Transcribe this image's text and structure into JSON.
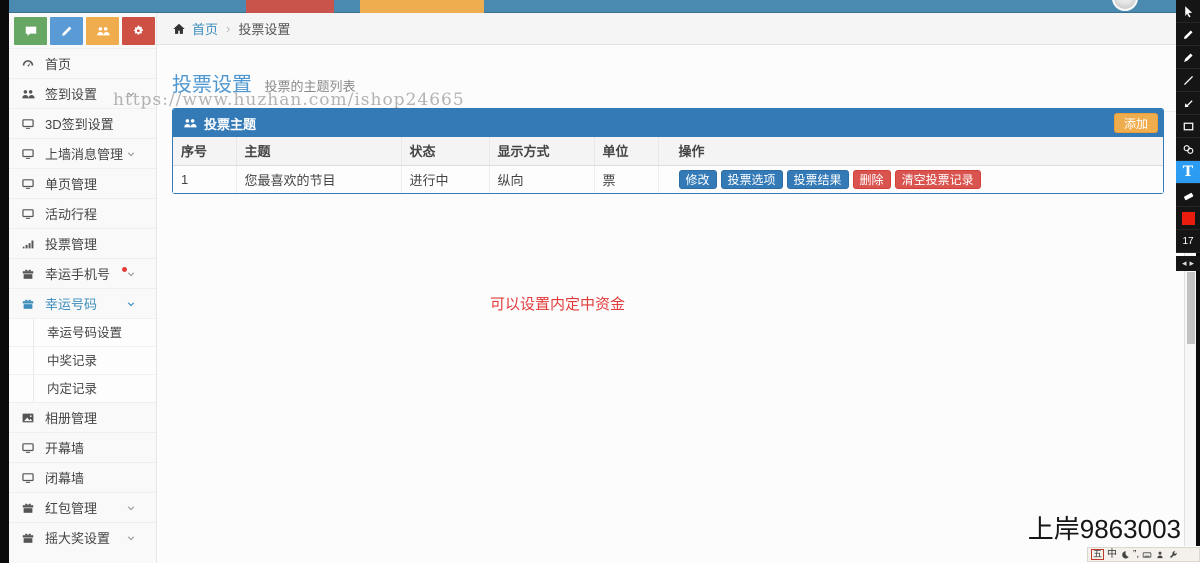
{
  "colors": {
    "navbar": "#4a8ab0",
    "accent_blue": "#3c8dbc",
    "panel_blue": "#337ab7",
    "warning_orange": "#f0ad4e",
    "danger_red": "#d9534f",
    "note_red": "#e23c3c",
    "toolbar_active_blue": "#2b9cf2",
    "swatch_red": "#ea1c0d"
  },
  "sidebar": {
    "quick_buttons": [
      {
        "name": "comments-button",
        "icon": "comment-icon",
        "color": "#67a764"
      },
      {
        "name": "edit-button",
        "icon": "pencil-icon",
        "color": "#5b9bd5"
      },
      {
        "name": "users-button",
        "icon": "users-icon",
        "color": "#f0ad4e"
      },
      {
        "name": "settings-button",
        "icon": "cogs-icon",
        "color": "#ce4f43"
      }
    ],
    "items": [
      {
        "label": "首页",
        "icon": "dashboard-icon"
      },
      {
        "label": "签到设置",
        "icon": "users-icon",
        "chevron": true
      },
      {
        "label": "3D签到设置",
        "icon": "desktop-icon"
      },
      {
        "label": "上墙消息管理",
        "icon": "desktop-icon",
        "chevron": true
      },
      {
        "label": "单页管理",
        "icon": "desktop-icon"
      },
      {
        "label": "活动行程",
        "icon": "desktop-icon"
      },
      {
        "label": "投票管理",
        "icon": "chart-icon"
      },
      {
        "label": "幸运手机号",
        "icon": "gift-icon",
        "chevron": true,
        "dot": true
      },
      {
        "label": "幸运号码",
        "icon": "gift-icon",
        "chevron": true,
        "active": true,
        "children": [
          "幸运号码设置",
          "中奖记录",
          "内定记录"
        ]
      },
      {
        "label": "相册管理",
        "icon": "image-icon"
      },
      {
        "label": "开幕墙",
        "icon": "desktop-icon"
      },
      {
        "label": "闭幕墙",
        "icon": "desktop-icon"
      },
      {
        "label": "红包管理",
        "icon": "gift-icon",
        "chevron": true
      },
      {
        "label": "摇大奖设置",
        "icon": "gift-icon",
        "chevron": true
      }
    ]
  },
  "breadcrumb": {
    "home": "首页",
    "current": "投票设置"
  },
  "page": {
    "title": "投票设置",
    "subtitle": "投票的主题列表"
  },
  "panel": {
    "title": "投票主题",
    "add_button": "添加"
  },
  "table": {
    "headers": [
      "序号",
      "主题",
      "状态",
      "显示方式",
      "单位",
      "操作"
    ],
    "rows": [
      {
        "no": "1",
        "topic": "您最喜欢的节目",
        "status": "进行中",
        "display": "纵向",
        "unit": "票",
        "actions": [
          {
            "label": "修改",
            "style": "primary"
          },
          {
            "label": "投票选项",
            "style": "primary"
          },
          {
            "label": "投票结果",
            "style": "primary"
          },
          {
            "label": "删除",
            "style": "danger"
          },
          {
            "label": "清空投票记录",
            "style": "danger"
          }
        ]
      }
    ]
  },
  "annotations": {
    "watermark": "https://www.huzhan.com/ishop24665",
    "note_text": "可以设置内定中资金",
    "bottom_text": "上岸9863003"
  },
  "annotation_toolbar": {
    "tools": [
      {
        "name": "cursor-tool",
        "type": "icon",
        "icon": "cursor-icon"
      },
      {
        "name": "pencil-tool",
        "type": "icon",
        "icon": "pencil-icon"
      },
      {
        "name": "marker-tool",
        "type": "icon",
        "icon": "marker-icon"
      },
      {
        "name": "line-tool",
        "type": "icon",
        "icon": "line-icon"
      },
      {
        "name": "arrow-tool",
        "type": "icon",
        "icon": "arrow-icon"
      },
      {
        "name": "rectangle-tool",
        "type": "icon",
        "icon": "rectangle-icon"
      },
      {
        "name": "steps-tool",
        "type": "icon",
        "icon": "steps-icon"
      },
      {
        "name": "text-tool",
        "type": "text",
        "active": true
      },
      {
        "name": "eraser-tool",
        "type": "icon",
        "icon": "eraser-icon"
      },
      {
        "name": "color-swatch",
        "type": "swatch"
      },
      {
        "name": "size-indicator",
        "type": "label",
        "label": "17"
      }
    ]
  },
  "ime_bar": {
    "icons": [
      {
        "name": "wubi-indicator",
        "glyph": "五",
        "boxed": true
      },
      {
        "name": "chinese-mode",
        "glyph": "中"
      },
      {
        "name": "moon-icon",
        "icon": "moon-icon"
      },
      {
        "name": "punctuation-mode",
        "glyph": "”,"
      },
      {
        "name": "keyboard-icon",
        "icon": "keyboard-icon"
      },
      {
        "name": "user-icon",
        "icon": "user-icon"
      },
      {
        "name": "wrench-icon",
        "icon": "wrench-icon"
      }
    ]
  }
}
